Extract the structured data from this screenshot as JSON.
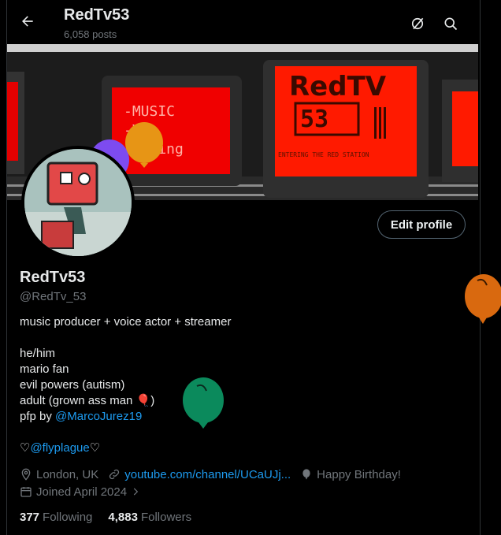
{
  "header": {
    "title": "RedTv53",
    "posts_count": "6,058 posts",
    "back_icon": "arrow-left-icon",
    "grok_icon": "slash-circle-icon",
    "search_icon": "search-icon"
  },
  "banner": {
    "tv_center_text_1": "RedTV",
    "tv_center_text_2": "53",
    "tv_center_subtext": "ENTERING THE RED STATION",
    "tv_left_lines": [
      "-MUSIC",
      "-VA",
      "-Gaming"
    ]
  },
  "profile": {
    "edit_label": "Edit profile",
    "name": "RedTv53",
    "handle": "@RedTv_53",
    "bio_line1": "music producer + voice actor + streamer",
    "bio_line2": "he/him",
    "bio_line3": "mario fan",
    "bio_line4": "evil powers (autism)",
    "bio_line5_text": "adult (grown ass man ",
    "bio_line5_emoji": "🎈",
    "bio_line5_end": ")",
    "pfp_prefix": "pfp by ",
    "pfp_link": "@MarcoJurez19",
    "heart_left": "♡",
    "heart_link": "@flyplague",
    "heart_right": "♡"
  },
  "meta": {
    "location": "London, UK",
    "website": "youtube.com/channel/UCaUJj...",
    "birthday": "Happy Birthday!",
    "joined": "Joined April 2024"
  },
  "stats": {
    "following_count": "377",
    "following_label": "Following",
    "followers_count": "4,883",
    "followers_label": "Followers"
  },
  "colors": {
    "accent": "#1d9bf0",
    "muted": "#71767b",
    "balloon_orange": "#d9690f",
    "balloon_green": "#0b8a5c",
    "balloon_purple": "#7d4bf0"
  }
}
